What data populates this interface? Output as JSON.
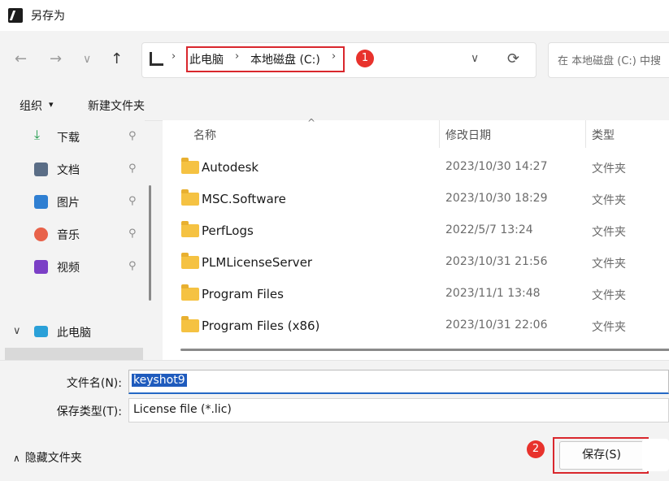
{
  "window": {
    "title": "另存为",
    "icon": "app-icon"
  },
  "nav": {
    "back_icon": "←",
    "forward_icon": "→",
    "dropdown_icon": "∨",
    "up_icon": "↑",
    "breadcrumb": [
      "此电脑",
      "本地磁盘 (C:)"
    ],
    "separator": "›",
    "badge1": "1",
    "history_icon": "∨",
    "refresh_icon": "⟳"
  },
  "search": {
    "placeholder": "在 本地磁盘 (C:) 中搜"
  },
  "toolbar": {
    "organize": "组织",
    "organize_caret": "▾",
    "new_folder": "新建文件夹"
  },
  "sidebar": {
    "pin_icon": "📌",
    "items": [
      {
        "label": "下载",
        "icon": "download-icon",
        "color": "#1d9a4a"
      },
      {
        "label": "文档",
        "icon": "document-icon",
        "color": "#5a6d86"
      },
      {
        "label": "图片",
        "icon": "pictures-icon",
        "color": "#2f7fd2"
      },
      {
        "label": "音乐",
        "icon": "music-icon",
        "color": "#e8624a"
      },
      {
        "label": "视频",
        "icon": "video-icon",
        "color": "#7b3fc6"
      }
    ],
    "this_pc": {
      "label": "此电脑",
      "chevron": "∨"
    }
  },
  "file_list": {
    "columns": {
      "name": "名称",
      "date": "修改日期",
      "type": "类型"
    },
    "sort_indicator": "^",
    "rows": [
      {
        "name": "Autodesk",
        "date": "2023/10/30 14:27",
        "type": "文件夹"
      },
      {
        "name": "MSC.Software",
        "date": "2023/10/30 18:29",
        "type": "文件夹"
      },
      {
        "name": "PerfLogs",
        "date": "2022/5/7 13:24",
        "type": "文件夹"
      },
      {
        "name": "PLMLicenseServer",
        "date": "2023/10/31 21:56",
        "type": "文件夹"
      },
      {
        "name": "Program Files",
        "date": "2023/11/1 13:48",
        "type": "文件夹"
      },
      {
        "name": "Program Files (x86)",
        "date": "2023/10/31 22:06",
        "type": "文件夹"
      }
    ]
  },
  "form": {
    "filename_label": "文件名(N):",
    "filename_value": "keyshot9",
    "filetype_label": "保存类型(T):",
    "filetype_value": "License file (*.lic)"
  },
  "footer": {
    "hide_folders": "隐藏文件夹",
    "hide_caret": "∧",
    "badge2": "2",
    "save_label": "保存(S)"
  },
  "colors": {
    "accent": "#2468c5",
    "highlight_red": "#d9272d",
    "badge_red": "#e8322c",
    "folder": "#f5c242"
  }
}
